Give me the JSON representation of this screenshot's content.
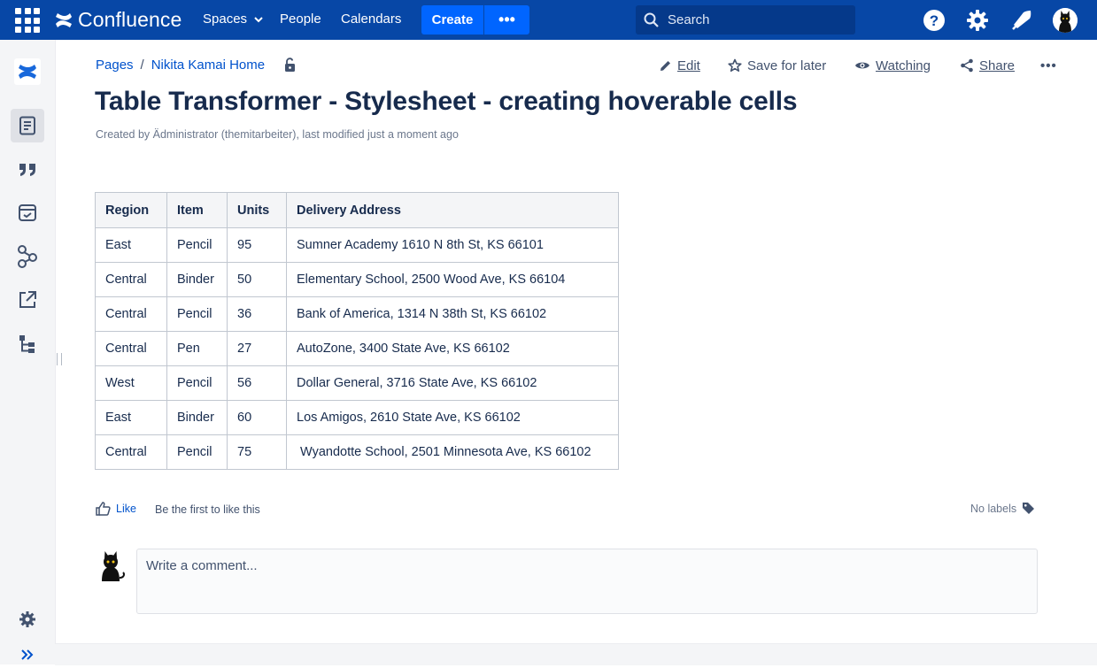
{
  "topbar": {
    "app_name": "Confluence",
    "nav": [
      "Spaces",
      "People",
      "Calendars"
    ],
    "create_label": "Create",
    "more_label": "•••",
    "search_placeholder": "Search",
    "icons": [
      "apps-icon",
      "help-icon",
      "settings-icon",
      "notifications-icon",
      "user-avatar"
    ]
  },
  "sidebar": {
    "icons": [
      "confluence-logo-icon",
      "pages-icon",
      "blog-quote-icon",
      "calendar-icon",
      "workflow-icon",
      "external-link-icon",
      "page-tree-icon",
      "space-settings-icon",
      "expand-sidebar-icon"
    ]
  },
  "breadcrumb": {
    "items": [
      "Pages",
      "Nikita Kamai Home"
    ],
    "separator": "/"
  },
  "actions": {
    "edit": "Edit",
    "save_for_later": "Save for later",
    "watching": "Watching",
    "share": "Share",
    "more": "•••"
  },
  "page": {
    "title": "Table Transformer - Stylesheet - creating hoverable cells",
    "byline": "Created by Ädministrator (themitarbeiter), last modified just a moment ago"
  },
  "table": {
    "headers": [
      "Region",
      "Item",
      "Units",
      "Delivery Address"
    ],
    "rows": [
      [
        "East",
        "Pencil",
        "95",
        "Sumner Academy 1610 N 8th St, KS 66101"
      ],
      [
        "Central",
        "Binder",
        "50",
        "Elementary School, 2500 Wood Ave, KS 66104"
      ],
      [
        "Central",
        "Pencil",
        "36",
        "Bank of America, 1314 N 38th St, KS 66102"
      ],
      [
        "Central",
        "Pen",
        "27",
        "AutoZone, 3400 State Ave, KS 66102"
      ],
      [
        "West",
        "Pencil",
        "56",
        "Dollar General, 3716 State Ave, KS 66102"
      ],
      [
        "East",
        "Binder",
        "60",
        "Los Amigos, 2610 State Ave, KS 66102"
      ],
      [
        "Central",
        "Pencil",
        "75",
        " Wyandotte School, 2501 Minnesota Ave, KS 66102"
      ]
    ]
  },
  "footer": {
    "like_label": "Like",
    "like_note": "Be the first to like this",
    "labels_text": "No labels",
    "comment_placeholder": "Write a comment..."
  },
  "colors": {
    "topbar": "#0747a6",
    "create": "#0065ff",
    "link": "#0052cc",
    "text": "#172b4d"
  }
}
